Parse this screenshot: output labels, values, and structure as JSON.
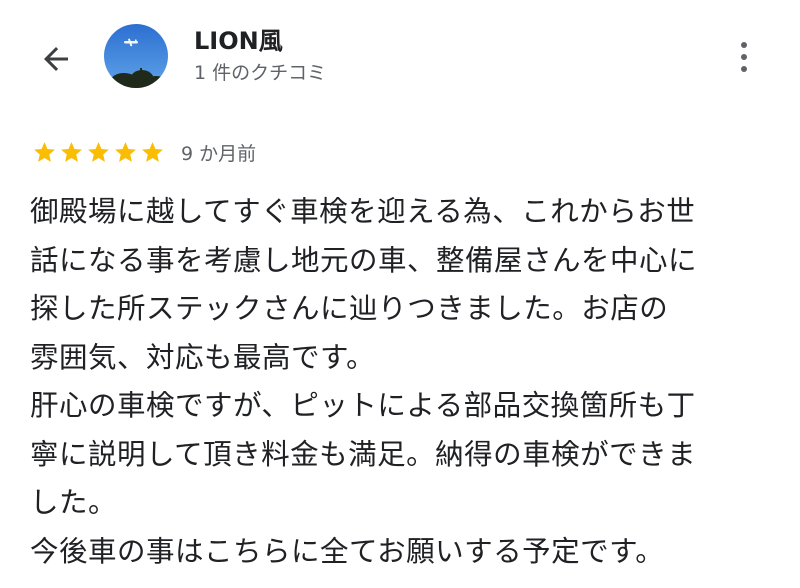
{
  "header": {
    "back_icon": "arrow-left-icon",
    "reviewer_name": "LION風",
    "review_count": "1 件のクチコミ",
    "more_icon": "more-vertical-icon"
  },
  "review": {
    "rating": 5,
    "rating_max": 5,
    "star_color": "#fbbc04",
    "date": "9 か月前",
    "lines": [
      "御殿場に越してすぐ車検を迎える為、これからお世",
      "話になる事を考慮し地元の車、整備屋さんを中心に",
      "探した所ステックさんに辿りつきました。お店の",
      "雰囲気、対応も最高です。",
      "肝心の車検ですが、ピットによる部品交換箇所も丁",
      "寧に説明して頂き料金も満足。納得の車検ができま",
      "した。",
      "今後車の事はこちらに全てお願いする予定です。"
    ]
  },
  "colors": {
    "text_primary": "#202124",
    "text_secondary": "#5f6368",
    "background": "#ffffff"
  }
}
